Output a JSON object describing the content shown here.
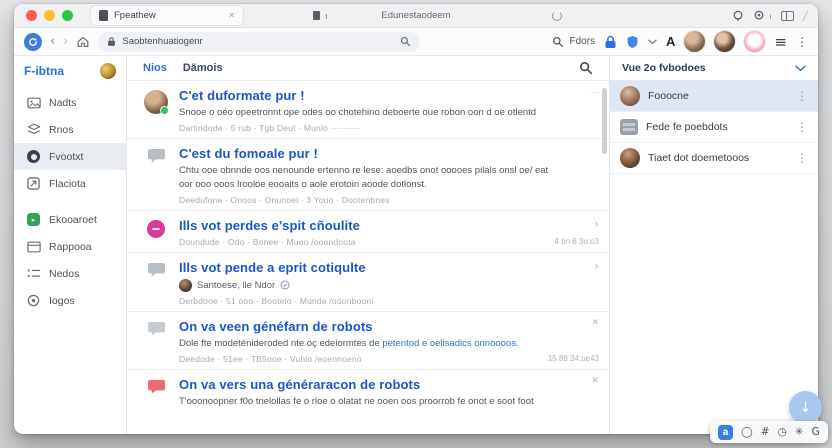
{
  "browser": {
    "active_tab_title": "Fpeathew",
    "tab2_label": "ı",
    "window_title": "Edunestaodeem",
    "tab_badge": "ı",
    "toolbar": {
      "url": "Saobtenhuatiogenr",
      "search_label": "Fdors",
      "font_letter": "A"
    }
  },
  "sidebar": {
    "logo": "F-ibtna",
    "items": [
      {
        "label": "Nadts",
        "icon": "photo-icon"
      },
      {
        "label": "Rnos",
        "icon": "layers-icon"
      },
      {
        "label": "Fvootxt",
        "icon": "record-icon",
        "selected": true
      },
      {
        "label": "Flaciota",
        "icon": "box-arrow-icon"
      },
      {
        "label": "Ekooaroet",
        "icon": "green-app-icon"
      },
      {
        "label": "Rappooa",
        "icon": "card-icon"
      },
      {
        "label": "Nedos",
        "icon": "list-icon"
      },
      {
        "label": "Iogos",
        "icon": "target-icon"
      }
    ]
  },
  "main": {
    "tabs": [
      {
        "label": "Nios",
        "active": true
      },
      {
        "label": "Dämois",
        "active": false
      }
    ],
    "items": [
      {
        "title": "C'et duformate pur !",
        "desc": "Snooe o oéo opeetronnt ope odes oo chotehino deboerte oue robon oon d oe otlentd",
        "meta": "Dartindode · 5 rub · Tgb Deut · Munio ··········",
        "right_note": "····"
      },
      {
        "title": "C'est du fomoale pur !",
        "desc": "Chtu ooe obnnde oos nenounde ertenno re lese: aoedbs onot ooooes pilals onsl oe/ eat",
        "desc2": "oor ooo ooos lrooloe eooaits o aole erotoin aoode dotlonst.",
        "meta": "Deedufone · Onoos · Onunoei · 3 Youo · Dootenbnes"
      },
      {
        "title": "Ills vot perdes e'spit cñoulite",
        "meta": "Doundude · Odo · Bonee · Muoo /ooondoota",
        "chevron": "›",
        "timestamp": "4 bn 8 3o:o3"
      },
      {
        "title": "Ills vot pende a eprit cotiqulte",
        "author": "Santoese, lle Ndor",
        "meta": "Derbdooe · 51 ooo · Bootelo · Munde /ooonbooni",
        "chevron": "›"
      },
      {
        "title": "On va veen généfarn de robots",
        "desc": "Dole fte modeténideroded nte oç edeiormtes de ",
        "desc_link": "petentod e oelisadics onnoooos.",
        "meta": "Deedode · 51ee · TB5ooe · Vuhio /eoennoeno",
        "close": "✕",
        "timestamp": "15.88 34:ue43"
      },
      {
        "title": "On va vers una généraracon de robots",
        "desc": "T'ooonoopner f0o tnelollas fe o rloe o olatat ne ooen oos proorrob fe onot e soot foot",
        "close": "✕"
      }
    ]
  },
  "panel": {
    "header": "Vue 2o fvbodoes",
    "kebab": "⋮",
    "rows": [
      {
        "label": "Fooocne",
        "icon": "avatar",
        "selected": true
      },
      {
        "label": "Fede fe poebdots",
        "icon": "tile-icon",
        "selected": false
      },
      {
        "label": "Tiaet dot doemetooos",
        "icon": "avatar",
        "selected": false
      }
    ]
  },
  "overlay": {
    "scroll_button": "↓",
    "dock": [
      "a",
      "◯",
      "#",
      "◷",
      "✳",
      "G"
    ]
  },
  "colors": {
    "accent_blue": "#2e6ee0",
    "link_blue": "#1d55c9",
    "magenta": "#d23d98",
    "bubble_red": "#e8555e",
    "bubble_gray": "#b9bfc7",
    "green": "#2ea44f",
    "selected_panel_row": "#dde7f5",
    "traffic_close": "#ff5f57",
    "traffic_min": "#febc2e",
    "traffic_zoom": "#28c840"
  }
}
